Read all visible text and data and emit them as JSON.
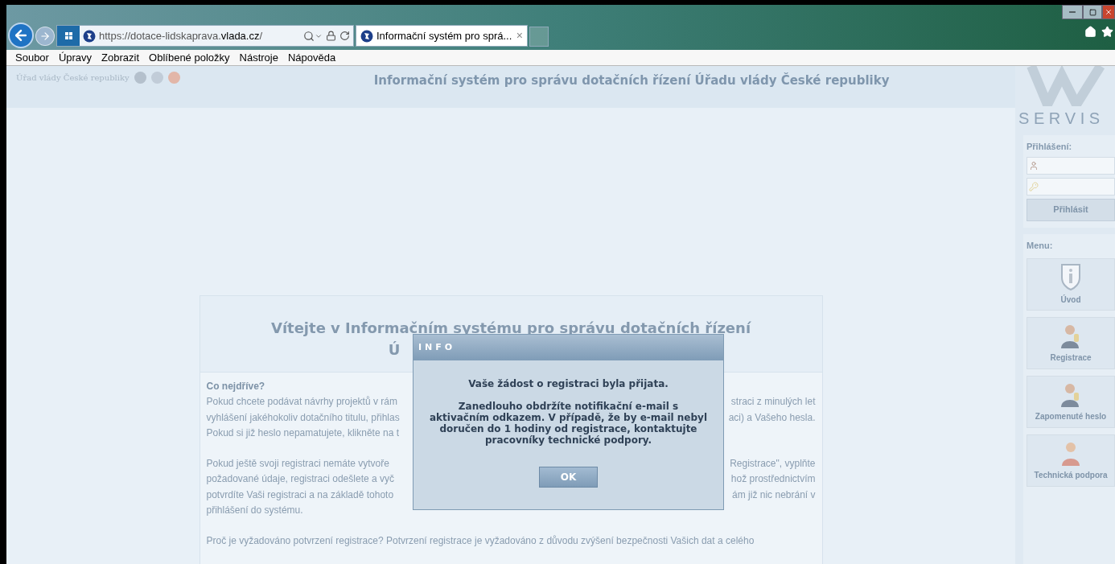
{
  "browser": {
    "url_parts": [
      {
        "text": "https://",
        "strong": false
      },
      {
        "text": "dotace-lidskaprava.",
        "strong": false
      },
      {
        "text": "vlada.cz",
        "strong": true
      },
      {
        "text": "/",
        "strong": false
      }
    ],
    "tab": {
      "title": "Informační systém pro sprá...",
      "close": "×",
      "selected": true
    },
    "menu": [
      "Soubor",
      "Úpravy",
      "Zobrazit",
      "Oblíbené položky",
      "Nástroje",
      "Nápověda"
    ]
  },
  "header": {
    "office": "Úřad vlády České republiky",
    "title": "Informační systém pro správu dotačních řízení Úřadu vlády České republiky"
  },
  "sidebar": {
    "logo_text": "S E R V I S",
    "login_label": "Přihlášení:",
    "login_button": "Přihlásit",
    "menu_label": "Menu:",
    "items": [
      {
        "label": "Úvod",
        "kind": "info"
      },
      {
        "label": "Registrace",
        "kind": "person"
      },
      {
        "label": "Zapomenuté heslo",
        "kind": "person"
      },
      {
        "label": "Technická podpora",
        "kind": "support"
      }
    ]
  },
  "content": {
    "heading": "Vítejte v Informačním systému pro správu dotačních řízení",
    "heading_line2": "Ú",
    "section_title": "Co nejdříve?",
    "paragraphs": [
      [
        {
          "left": "Pokud chcete podávat návrhy projektů v rám",
          "right": "straci z minulých let"
        },
        {
          "left": "vyhlášení jakéhokoliv dotačního titulu, přihlas",
          "right": "aci) a Vašeho hesla."
        },
        {
          "left": "Pokud si již heslo nepamatujete, klikněte na t"
        }
      ],
      [
        {
          "left": "Pokud ještě svoji registraci nemáte vytvoře",
          "right": "Registrace\", vyplňte"
        },
        {
          "left": "požadované údaje, registraci odešlete a vyč",
          "right": "hož prostřednictvím"
        },
        {
          "left": "potvrdíte Vaši registraci a na základě tohoto",
          "right": "ám již nic nebrání v"
        },
        {
          "left": "přihlášení do systému."
        }
      ],
      [
        {
          "left": "Proč je vyžadováno potvrzení registrace? Potvrzení registrace je vyžadováno z důvodu zvýšení bezpečnosti Vašich dat a celého"
        }
      ]
    ]
  },
  "dialog": {
    "title": "INFO",
    "message": "Vaše žádost o registraci byla přijata.",
    "details": "Zanedlouho obdržíte notifikační e-mail s aktivačním odkazem. V případě, že by e-mail nebyl doručen do 1 hodiny od registrace, kontaktujte pracovníky technické podpory.",
    "button": "OK"
  }
}
